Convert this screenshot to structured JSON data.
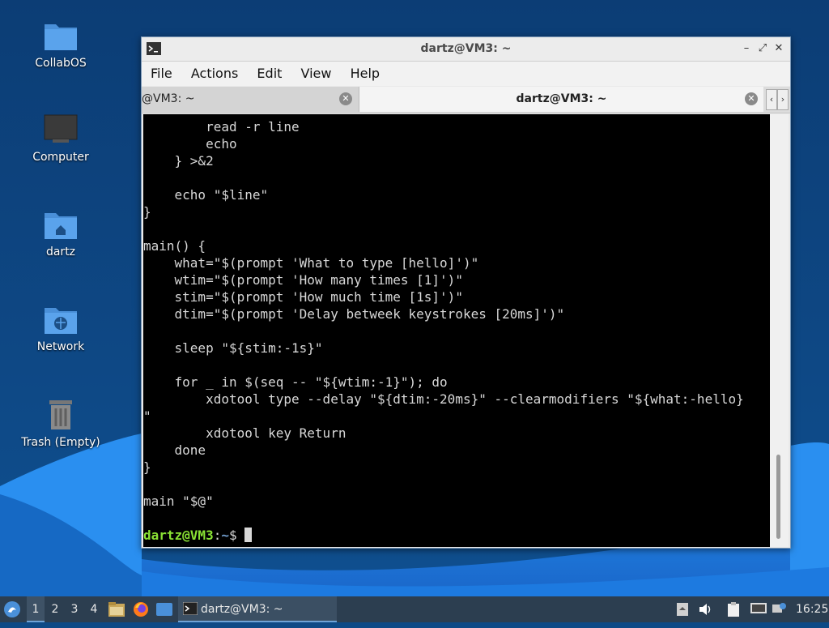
{
  "desktop": {
    "icons": [
      {
        "label": "CollabOS"
      },
      {
        "label": "Computer"
      },
      {
        "label": "dartz"
      },
      {
        "label": "Network"
      },
      {
        "label": "Trash (Empty)"
      }
    ]
  },
  "window": {
    "title": "dartz@VM3: ~",
    "menu": [
      "File",
      "Actions",
      "Edit",
      "View",
      "Help"
    ],
    "tabs": [
      {
        "label": "@VM3: ~",
        "active": false
      },
      {
        "label": "dartz@VM3: ~",
        "active": true
      }
    ],
    "terminal": {
      "lines": [
        "        read -r line",
        "        echo",
        "    } >&2",
        "",
        "    echo \"$line\"",
        "}",
        "",
        "main() {",
        "    what=\"$(prompt 'What to type [hello]')\"",
        "    wtim=\"$(prompt 'How many times [1]')\"",
        "    stim=\"$(prompt 'How much time [1s]')\"",
        "    dtim=\"$(prompt 'Delay betweek keystrokes [20ms]')\"",
        "",
        "    sleep \"${stim:-1s}\"",
        "",
        "    for _ in $(seq -- \"${wtim:-1}\"); do",
        "        xdotool type --delay \"${dtim:-20ms}\" --clearmodifiers \"${what:-hello}",
        "\"",
        "        xdotool key Return",
        "    done",
        "}",
        "",
        "main \"$@\"",
        ""
      ],
      "prompt_user": "dartz@VM3",
      "prompt_sep": ":",
      "prompt_path": "~",
      "prompt_symbol": "$ "
    }
  },
  "taskbar": {
    "workspaces": [
      "1",
      "2",
      "3",
      "4"
    ],
    "task_label": "dartz@VM3: ~",
    "clock": "16:25"
  },
  "colors": {
    "prompt_user": "#8ae234",
    "prompt_path": "#729fcf",
    "taskbar_bg": "#2c3e50"
  }
}
